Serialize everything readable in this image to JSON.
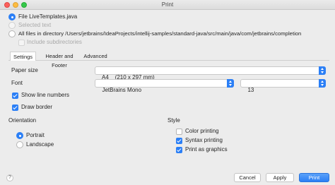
{
  "window": {
    "title": "Print"
  },
  "scope": {
    "file_label": "File LiveTemplates.java",
    "selected_text_label": "Selected text",
    "all_files_label": "All files in directory /Users/jetbrains/IdeaProjects/intellij-samples/standard-java/src/main/java/com/jetbrains/completion",
    "include_subdirectories_label": "Include subdirectories"
  },
  "tabs": [
    {
      "label": "Settings",
      "active": true
    },
    {
      "label": "Header and Footer",
      "active": false
    },
    {
      "label": "Advanced",
      "active": false
    }
  ],
  "settings": {
    "paper_size_label": "Paper size",
    "paper_size_value": "A4    (210 x 297 mm)",
    "font_label": "Font",
    "font_value": "JetBrains Mono",
    "font_size_value": "13",
    "show_line_numbers_label": "Show line numbers",
    "show_line_numbers_checked": true,
    "draw_border_label": "Draw border",
    "draw_border_checked": true
  },
  "orientation": {
    "heading": "Orientation",
    "portrait_label": "Portrait",
    "landscape_label": "Landscape",
    "selected": "Portrait"
  },
  "style": {
    "heading": "Style",
    "color_printing_label": "Color printing",
    "color_printing_checked": false,
    "syntax_printing_label": "Syntax printing",
    "syntax_printing_checked": true,
    "print_as_graphics_label": "Print as graphics",
    "print_as_graphics_checked": true
  },
  "footer": {
    "help_label": "?",
    "cancel_label": "Cancel",
    "apply_label": "Apply",
    "print_label": "Print"
  },
  "colors": {
    "accent": "#2b7ff6",
    "background": "#ececec"
  },
  "icons": {
    "help": "help-icon",
    "stepper": "stepper-icon"
  }
}
